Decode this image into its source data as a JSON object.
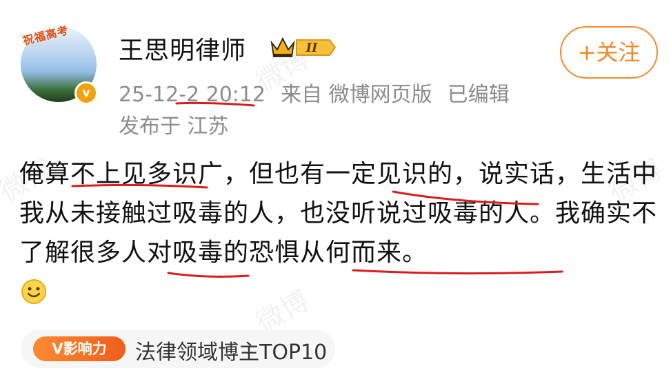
{
  "profile": {
    "avatar_banner": "祝福高考",
    "verify_badge": "v",
    "username": "王思明律师",
    "crown_level": "II"
  },
  "follow_button": "+关注",
  "meta": {
    "timestamp": "25-12-2 20:12",
    "source": "来自 微博网页版",
    "edited": "已编辑",
    "location": "发布于 江苏"
  },
  "post": {
    "text": "俺算不上见多识广，但也有一定见识的，说实话，生活中我从未接触过吸毒的人，也没听说过吸毒的人。我确实不了解很多人对吸毒的恐惧从何而来。",
    "emoji": "smile"
  },
  "influence": {
    "badge": "V影响力",
    "label": "法律领域博主TOP10"
  },
  "watermark": "微博",
  "colors": {
    "accent_orange": "#f08a2c",
    "annotation_red": "#d91c1c",
    "meta_gray": "#8c8c8c"
  }
}
